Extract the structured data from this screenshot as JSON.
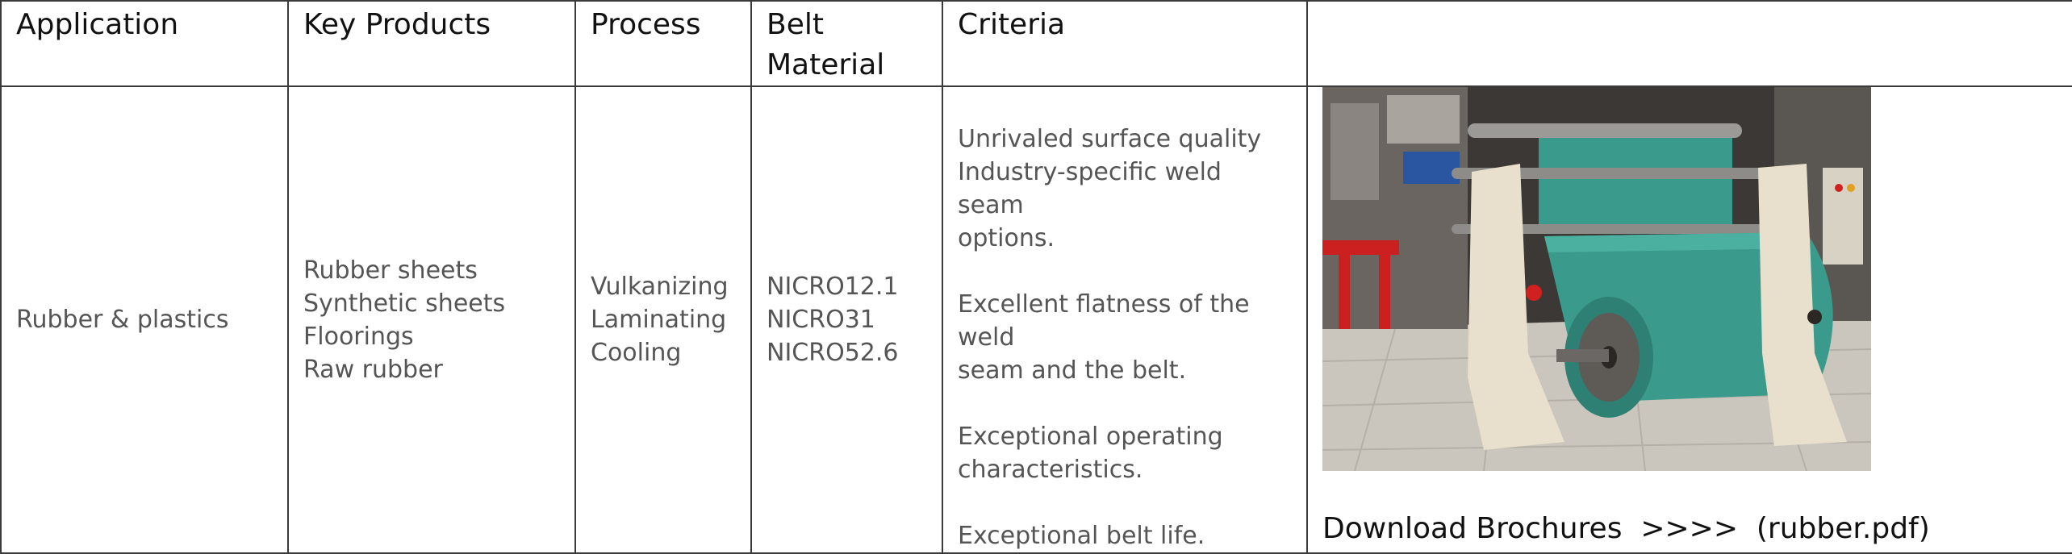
{
  "table": {
    "headers": {
      "application": "Application",
      "key_products": "Key Products",
      "process": "Process",
      "belt_material_line1": "Belt",
      "belt_material_line2": "Material",
      "criteria": "Criteria",
      "media": ""
    },
    "row": {
      "application": "Rubber & plastics",
      "key_products": [
        "Rubber sheets",
        "Synthetic sheets",
        "Floorings",
        "Raw rubber"
      ],
      "process": [
        "Vulkanizing",
        "Laminating",
        "Cooling"
      ],
      "belt_material": [
        "NICRO12.1",
        "NICRO31",
        "NICRO52.6"
      ],
      "criteria": [
        [
          "Unrivaled surface quality",
          "Industry-specific weld seam",
          "options."
        ],
        [
          "Excellent flatness of the weld",
          "seam and the belt."
        ],
        [
          "Exceptional operating",
          "characteristics."
        ],
        [
          "Exceptional belt life."
        ]
      ],
      "photo": {
        "subject": "conveyor-belt-machine-photo",
        "colors": {
          "belt": "#3a9a8c",
          "frame": "#e8e0cc",
          "floor": "#cfcac2",
          "accent_red": "#d02020"
        }
      },
      "download_link": "Download Brochures  >>>>  (rubber.pdf)"
    }
  }
}
